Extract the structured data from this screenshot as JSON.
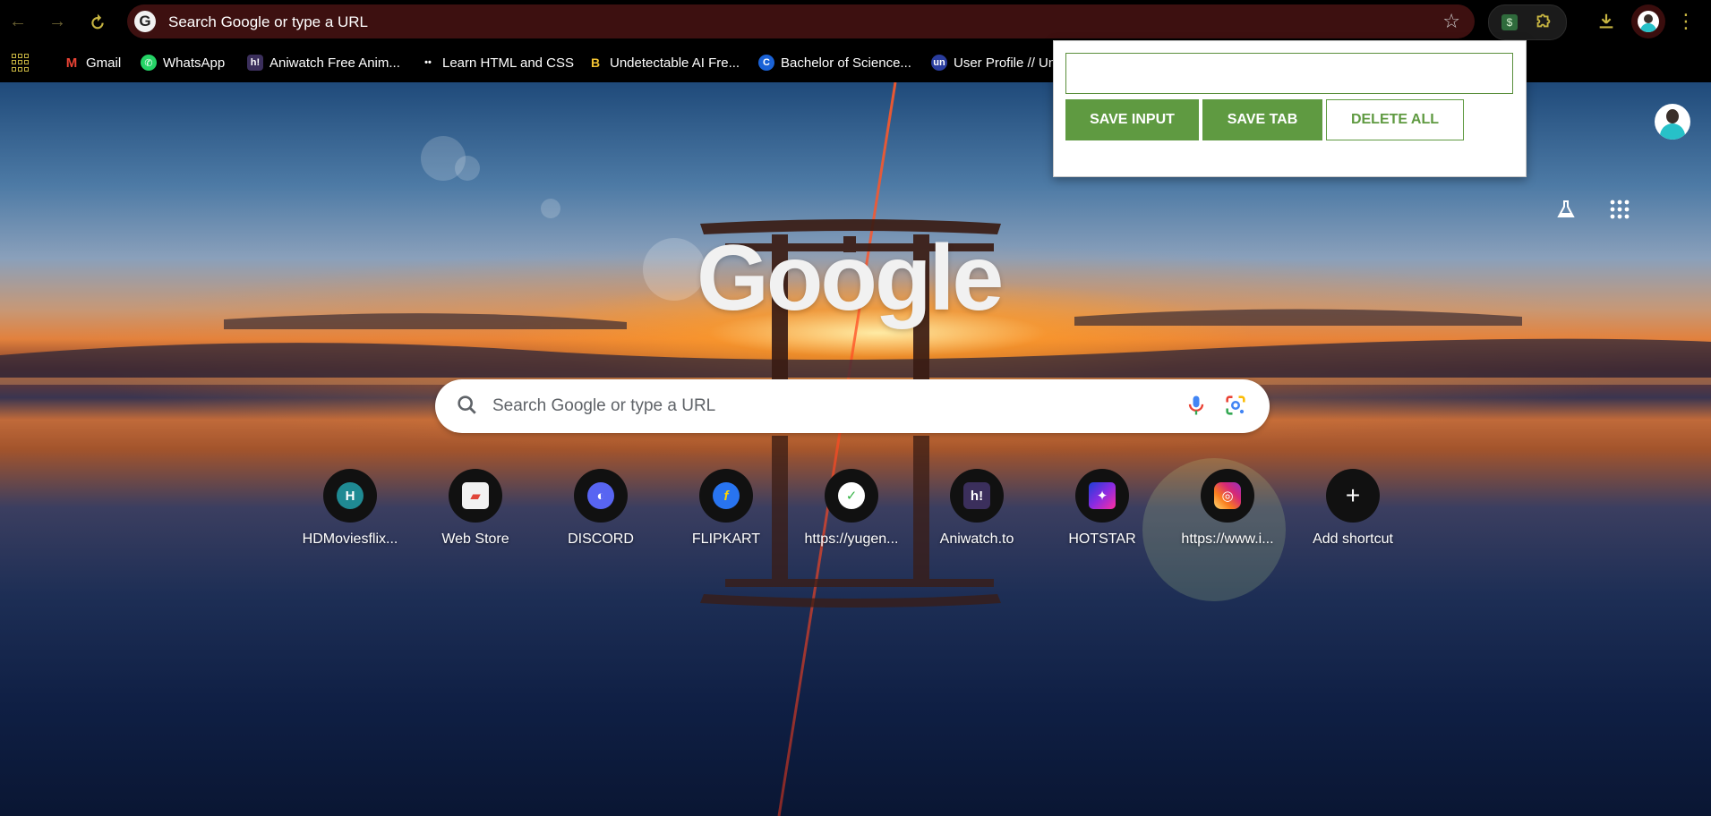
{
  "omnibox": {
    "placeholder": "Search Google or type a URL"
  },
  "toolbar": {
    "back_icon": "arrow-left-icon",
    "forward_icon": "arrow-right-icon",
    "reload_icon": "reload-icon",
    "extension_badge": "$"
  },
  "bookmarks": [
    {
      "label": "Gmail",
      "icon": "gmail-icon",
      "glyph": "M",
      "color": "#ea4335"
    },
    {
      "label": "WhatsApp",
      "icon": "whatsapp-icon",
      "glyph": "✆",
      "color": "#25d366"
    },
    {
      "label": "Aniwatch Free Anim...",
      "icon": "aniwatch-icon",
      "glyph": "h!",
      "color": "#3b2f5c"
    },
    {
      "label": "Learn HTML and CSS",
      "icon": "html-course-icon",
      "glyph": "••",
      "color": "#222222"
    },
    {
      "label": "Undetectable AI Fre...",
      "icon": "undetectable-ai-icon",
      "glyph": "B",
      "color": "#111111"
    },
    {
      "label": "Bachelor of Science...",
      "icon": "bachelor-course-icon",
      "glyph": "C",
      "color": "#1a62d6"
    },
    {
      "label": "User Profile // Un",
      "icon": "unstop-icon",
      "glyph": "un",
      "color": "#2a3d9e"
    }
  ],
  "logo": "Google",
  "search": {
    "placeholder": "Search Google or type a URL"
  },
  "shortcuts": [
    {
      "label": "HDMoviesflix...",
      "glyph": "H",
      "bg": "#1f8a93",
      "fg": "#ffffff"
    },
    {
      "label": "Web Store",
      "glyph": "▰",
      "bg": "#f2f2f2",
      "fg": "#e0463a"
    },
    {
      "label": "DISCORD",
      "glyph": "◐",
      "bg": "#5865f2",
      "fg": "#ffffff"
    },
    {
      "label": "FLIPKART",
      "glyph": "f",
      "bg": "#2874f0",
      "fg": "#ffd400"
    },
    {
      "label": "https://yugen...",
      "glyph": "✓",
      "bg": "#ffffff",
      "fg": "#3ab54a"
    },
    {
      "label": "Aniwatch.to",
      "glyph": "h!",
      "bg": "#3b2f5c",
      "fg": "#ffffff"
    },
    {
      "label": "HOTSTAR",
      "glyph": "✦",
      "bg": "#1c3fd6",
      "fg": "#ff2ea0"
    },
    {
      "label": "https://www.i...",
      "glyph": "◎",
      "bg": "#e1306c",
      "fg": "#ffffff"
    },
    {
      "label": "Add shortcut",
      "glyph": "+",
      "bg": "#111111",
      "fg": "#ffffff"
    }
  ],
  "popup": {
    "input_value": "",
    "save_input_label": "SAVE INPUT",
    "save_tab_label": "SAVE TAB",
    "delete_all_label": "DELETE ALL",
    "accent_color": "#5f9a41"
  }
}
